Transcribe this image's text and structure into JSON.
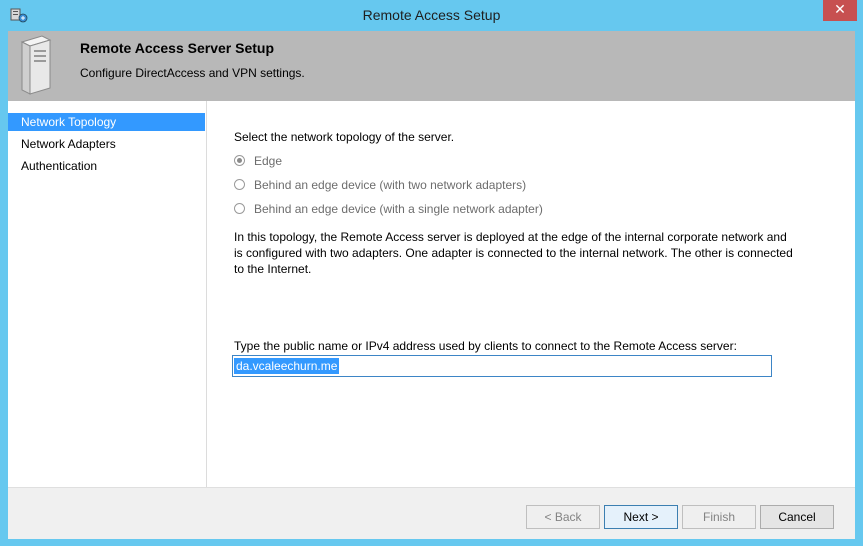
{
  "window": {
    "title": "Remote Access Setup",
    "close_glyph": "✕"
  },
  "header": {
    "title": "Remote Access Server Setup",
    "subtitle": "Configure DirectAccess and VPN settings."
  },
  "nav": {
    "items": [
      {
        "label": "Network Topology",
        "active": true
      },
      {
        "label": "Network Adapters",
        "active": false
      },
      {
        "label": "Authentication",
        "active": false
      }
    ]
  },
  "main": {
    "prompt": "Select the network topology of the server.",
    "options": [
      {
        "label": "Edge",
        "checked": true
      },
      {
        "label": "Behind an edge device (with two network adapters)",
        "checked": false
      },
      {
        "label": "Behind an edge device (with a single network adapter)",
        "checked": false
      }
    ],
    "description": "In this topology, the Remote Access server is deployed at the edge of the internal corporate network and is configured with two adapters. One adapter is connected to the internal network. The other is connected to the Internet.",
    "address_label": "Type the public name or IPv4 address used by clients to connect to the Remote Access server:",
    "address_value": "da.vcaleechurn.me"
  },
  "footer": {
    "back": "< Back",
    "next": "Next >",
    "finish": "Finish",
    "cancel": "Cancel"
  },
  "colors": {
    "titlebar": "#66c8ef",
    "header": "#b8b8b8",
    "selection": "#3399ff",
    "close": "#c75050"
  }
}
